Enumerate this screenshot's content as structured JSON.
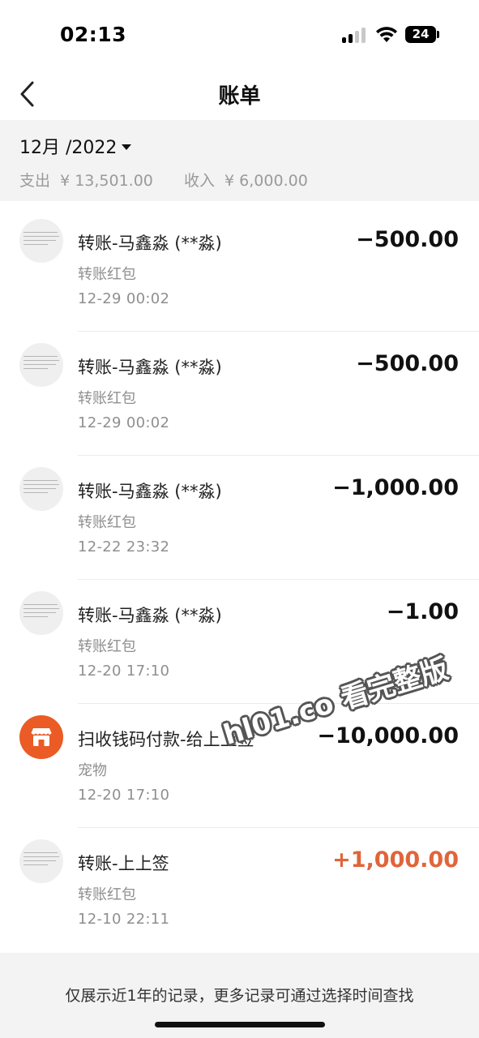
{
  "status_bar": {
    "time": "02:13",
    "battery": "24"
  },
  "nav": {
    "title": "账单"
  },
  "summary": {
    "month": "12月 /2022",
    "expense_label": "支出",
    "expense_value": "¥ 13,501.00",
    "income_label": "收入",
    "income_value": "¥ 6,000.00"
  },
  "transactions": [
    {
      "title": "转账-马鑫淼 (**淼)",
      "category": "转账红包",
      "time": "12-29  00:02",
      "amount": "−500.00",
      "type": "expense",
      "icon": "user-avatar-icon"
    },
    {
      "title": "转账-马鑫淼 (**淼)",
      "category": "转账红包",
      "time": "12-29  00:02",
      "amount": "−500.00",
      "type": "expense",
      "icon": "user-avatar-icon"
    },
    {
      "title": "转账-马鑫淼 (**淼)",
      "category": "转账红包",
      "time": "12-22  23:32",
      "amount": "−1,000.00",
      "type": "expense",
      "icon": "user-avatar-icon"
    },
    {
      "title": "转账-马鑫淼 (**淼)",
      "category": "转账红包",
      "time": "12-20  17:10",
      "amount": "−1.00",
      "type": "expense",
      "icon": "user-avatar-icon"
    },
    {
      "title": "扫收钱码付款-给上上签",
      "category": "宠物",
      "time": "12-20  17:10",
      "amount": "−10,000.00",
      "type": "expense",
      "icon": "store-icon"
    },
    {
      "title": "转账-上上签",
      "category": "转账红包",
      "time": "12-10  22:11",
      "amount": "+1,000.00",
      "type": "income",
      "icon": "user-avatar-icon"
    }
  ],
  "watermark": "hl01.co 看完整版",
  "footer": {
    "note": "仅展示近1年的记录，更多记录可通过选择时间查找"
  },
  "colors": {
    "income": "#e0653a",
    "store_icon": "#ea5b26",
    "header_bg": "#f3f3f3"
  }
}
